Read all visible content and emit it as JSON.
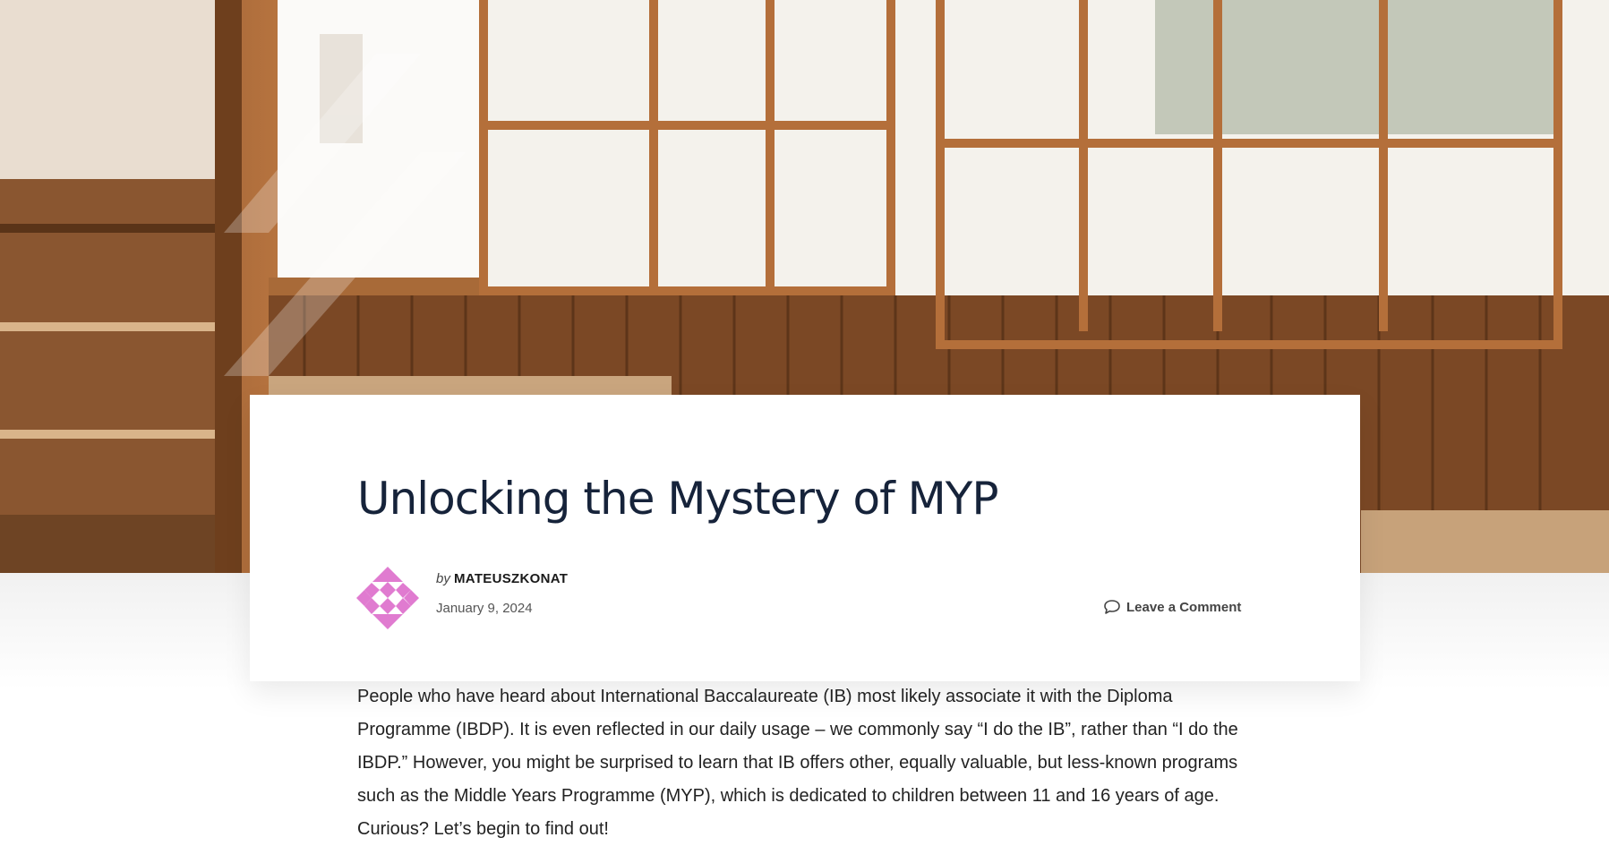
{
  "post": {
    "title": "Unlocking the Mystery of MYP",
    "by_label": "by",
    "author": "MATEUSZKONAT",
    "date": "January 9, 2024",
    "comment_link": "Leave a Comment",
    "intro": "People who have heard about International Baccalaureate (IB) most likely associate it with the  Diploma Programme (IBDP). It is even reflected in our daily usage – we commonly say “I do the IB”, rather than “I do the IBDP.” However, you might be surprised to learn that IB offers other, equally valuable, but less-known programs such as the Middle Years Programme (MYP), which is dedicated to children between 11 and 16 years of age. Curious? Let’s begin to find out!"
  },
  "icons": {
    "avatar": "pink-geometric-identicon",
    "comment": "speech-bubble-icon"
  },
  "colors": {
    "title": "#16233a",
    "avatar_pink": "#e07bd0",
    "text": "#222222"
  }
}
